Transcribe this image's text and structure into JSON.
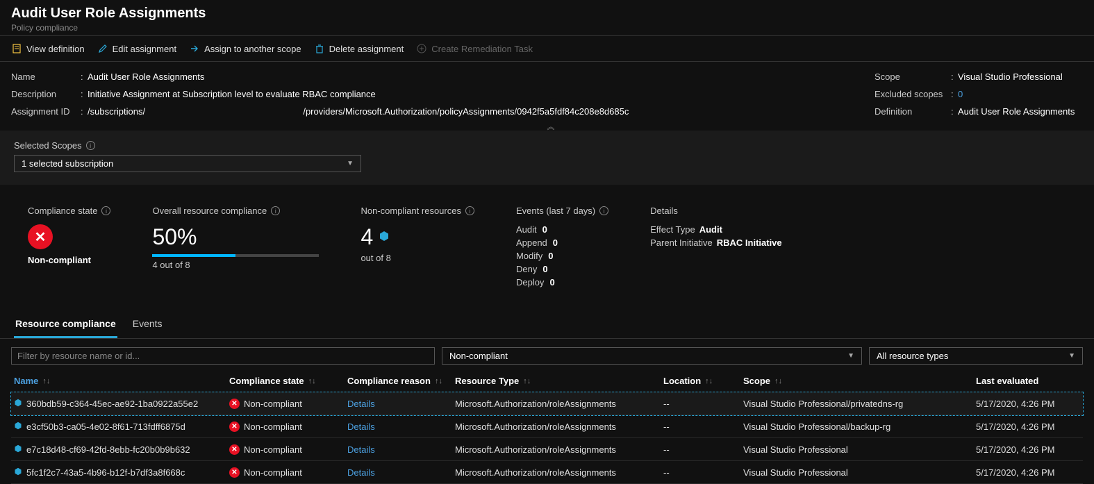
{
  "header": {
    "title": "Audit User Role Assignments",
    "subtitle": "Policy compliance"
  },
  "toolbar": {
    "view_definition": "View definition",
    "edit_assignment": "Edit assignment",
    "assign_scope": "Assign to another scope",
    "delete_assignment": "Delete assignment",
    "create_remediation": "Create Remediation Task"
  },
  "meta": {
    "name_label": "Name",
    "name_value": "Audit User Role Assignments",
    "desc_label": "Description",
    "desc_value": "Initiative Assignment at Subscription level to evaluate RBAC compliance",
    "assign_label": "Assignment ID",
    "assign_pre": "/subscriptions/",
    "assign_post": "/providers/Microsoft.Authorization/policyAssignments/0942f5a5fdf84c208e8d685c",
    "scope_label": "Scope",
    "scope_value": "Visual Studio Professional",
    "excluded_label": "Excluded scopes",
    "excluded_value": "0",
    "definition_label": "Definition",
    "definition_value": "Audit User Role Assignments"
  },
  "scopes": {
    "label": "Selected Scopes",
    "selected": "1 selected subscription"
  },
  "stats": {
    "compliance_state": {
      "title": "Compliance state",
      "state": "Non-compliant"
    },
    "overall": {
      "title": "Overall resource compliance",
      "percent": "50%",
      "sub": "4 out of 8",
      "fill": 50
    },
    "noncompliant": {
      "title": "Non-compliant resources",
      "count": "4",
      "sub": "out of 8"
    },
    "events": {
      "title": "Events (last 7 days)",
      "rows": [
        {
          "label": "Audit",
          "value": "0"
        },
        {
          "label": "Append",
          "value": "0"
        },
        {
          "label": "Modify",
          "value": "0"
        },
        {
          "label": "Deny",
          "value": "0"
        },
        {
          "label": "Deploy",
          "value": "0"
        }
      ]
    },
    "details": {
      "title": "Details",
      "rows": [
        {
          "label": "Effect Type",
          "value": "Audit"
        },
        {
          "label": "Parent Initiative",
          "value": "RBAC Initiative"
        }
      ]
    }
  },
  "tabs": {
    "resource_compliance": "Resource compliance",
    "events": "Events"
  },
  "filters": {
    "placeholder": "Filter by resource name or id...",
    "compliance": "Non-compliant",
    "types": "All resource types"
  },
  "columns": {
    "name": "Name",
    "state": "Compliance state",
    "reason": "Compliance reason",
    "type": "Resource Type",
    "location": "Location",
    "scope": "Scope",
    "eval": "Last evaluated"
  },
  "rows": [
    {
      "name": "360bdb59-c364-45ec-ae92-1ba0922a55e2",
      "state": "Non-compliant",
      "reason": "Details",
      "type": "Microsoft.Authorization/roleAssignments",
      "location": "--",
      "scope": "Visual Studio Professional/privatedns-rg",
      "eval": "5/17/2020, 4:26 PM"
    },
    {
      "name": "e3cf50b3-ca05-4e02-8f61-713fdff6875d",
      "state": "Non-compliant",
      "reason": "Details",
      "type": "Microsoft.Authorization/roleAssignments",
      "location": "--",
      "scope": "Visual Studio Professional/backup-rg",
      "eval": "5/17/2020, 4:26 PM"
    },
    {
      "name": "e7c18d48-cf69-42fd-8ebb-fc20b0b9b632",
      "state": "Non-compliant",
      "reason": "Details",
      "type": "Microsoft.Authorization/roleAssignments",
      "location": "--",
      "scope": "Visual Studio Professional",
      "eval": "5/17/2020, 4:26 PM"
    },
    {
      "name": "5fc1f2c7-43a5-4b96-b12f-b7df3a8f668c",
      "state": "Non-compliant",
      "reason": "Details",
      "type": "Microsoft.Authorization/roleAssignments",
      "location": "--",
      "scope": "Visual Studio Professional",
      "eval": "5/17/2020, 4:26 PM"
    }
  ]
}
